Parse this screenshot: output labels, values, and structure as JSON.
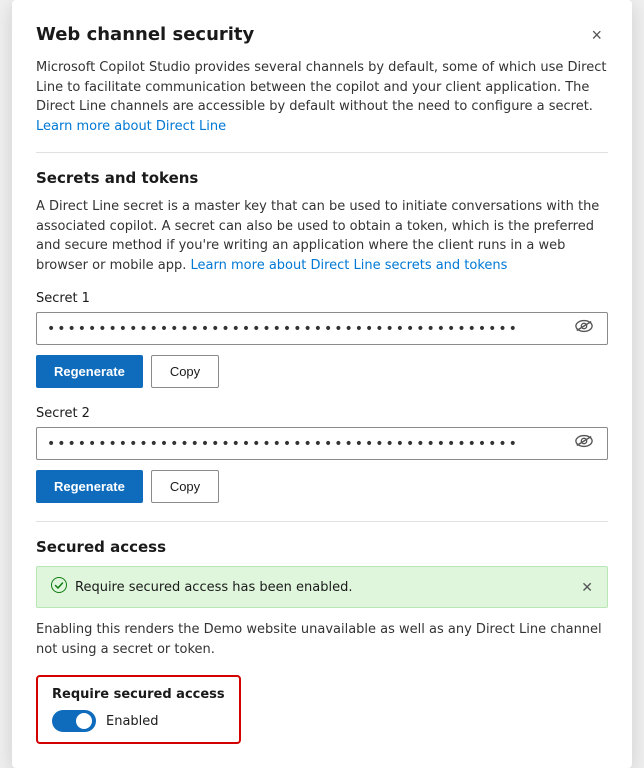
{
  "dialog": {
    "title": "Web channel security",
    "close_label": "×"
  },
  "intro": {
    "text": "Microsoft Copilot Studio provides several channels by default, some of which use Direct Line to facilitate communication between the copilot and your client application. The Direct Line channels are accessible by default without the need to configure a secret.",
    "link_text": "Learn more about Direct Line",
    "link_href": "#"
  },
  "secrets": {
    "section_title": "Secrets and tokens",
    "desc": "A Direct Line secret is a master key that can be used to initiate conversations with the associated copilot. A secret can also be used to obtain a token, which is the preferred and secure method if you're writing an application where the client runs in a web browser or mobile app.",
    "link_text": "Learn more about Direct Line secrets and tokens",
    "link_href": "#",
    "secret1": {
      "label": "Secret 1",
      "dots": "••••••••••••••••••••••••••••••••••••••••••••••",
      "regenerate_label": "Regenerate",
      "copy_label": "Copy"
    },
    "secret2": {
      "label": "Secret 2",
      "dots": "••••••••••••••••••••••••••••••••••••••••••••••",
      "regenerate_label": "Regenerate",
      "copy_label": "Copy"
    }
  },
  "secured_access": {
    "section_title": "Secured access",
    "banner_text": "Require secured access has been enabled.",
    "desc_text": "Enabling this renders the Demo website unavailable as well as any Direct Line channel not using a secret or token.",
    "toggle_label": "Require secured access",
    "toggle_state": "Enabled"
  },
  "icons": {
    "eye": "👁",
    "check": "✓",
    "close": "✕"
  }
}
